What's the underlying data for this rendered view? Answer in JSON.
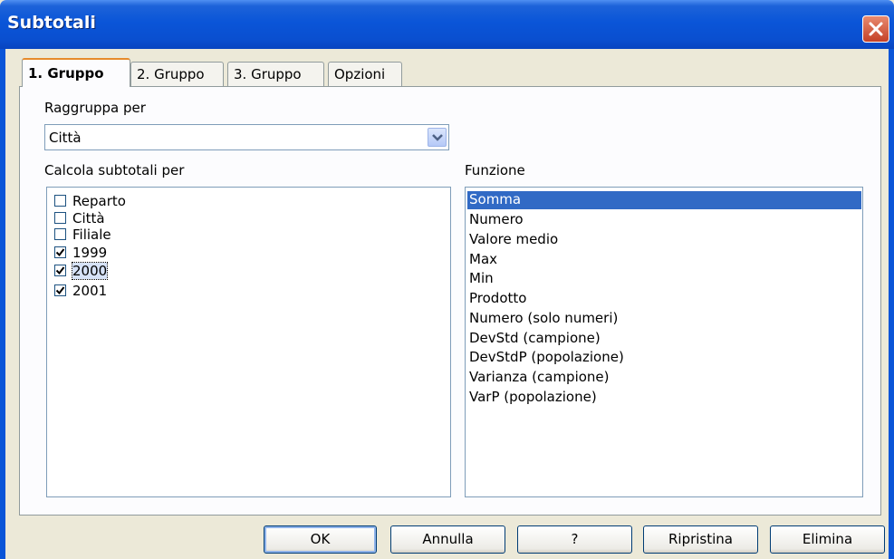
{
  "window": {
    "title": "Subtotali"
  },
  "tabs": [
    {
      "label": "1. Gruppo",
      "active": true
    },
    {
      "label": "2. Gruppo",
      "active": false
    },
    {
      "label": "3. Gruppo",
      "active": false
    },
    {
      "label": "Opzioni",
      "active": false
    }
  ],
  "group": {
    "label": "Raggruppa per",
    "selected_value": "Città"
  },
  "subtotals": {
    "label": "Calcola subtotali per",
    "columns": [
      {
        "label": "Reparto",
        "checked": false
      },
      {
        "label": "Città",
        "checked": false
      },
      {
        "label": "Filiale",
        "checked": false
      },
      {
        "label": "1999",
        "checked": true
      },
      {
        "label": "2000",
        "checked": true,
        "focused": true
      },
      {
        "label": "2001",
        "checked": true
      }
    ]
  },
  "function": {
    "label": "Funzione",
    "items": [
      "Somma",
      "Numero",
      "Valore medio",
      "Max",
      "Min",
      "Prodotto",
      "Numero (solo numeri)",
      "DevStd (campione)",
      "DevStdP (popolazione)",
      "Varianza (campione)",
      "VarP (popolazione)"
    ],
    "selected": "Somma"
  },
  "buttons": {
    "ok": "OK",
    "cancel": "Annulla",
    "help": "?",
    "reset": "Ripristina",
    "delete": "Elimina"
  },
  "icons": {
    "close": "close-icon",
    "dropdown": "chevron-down-icon",
    "check": "checkmark-icon"
  },
  "colors": {
    "titlebar": "#0a55d8",
    "active_tab_accent": "#e68b2c",
    "selection": "#316ac5",
    "dialog_bg": "#ece9d8"
  }
}
